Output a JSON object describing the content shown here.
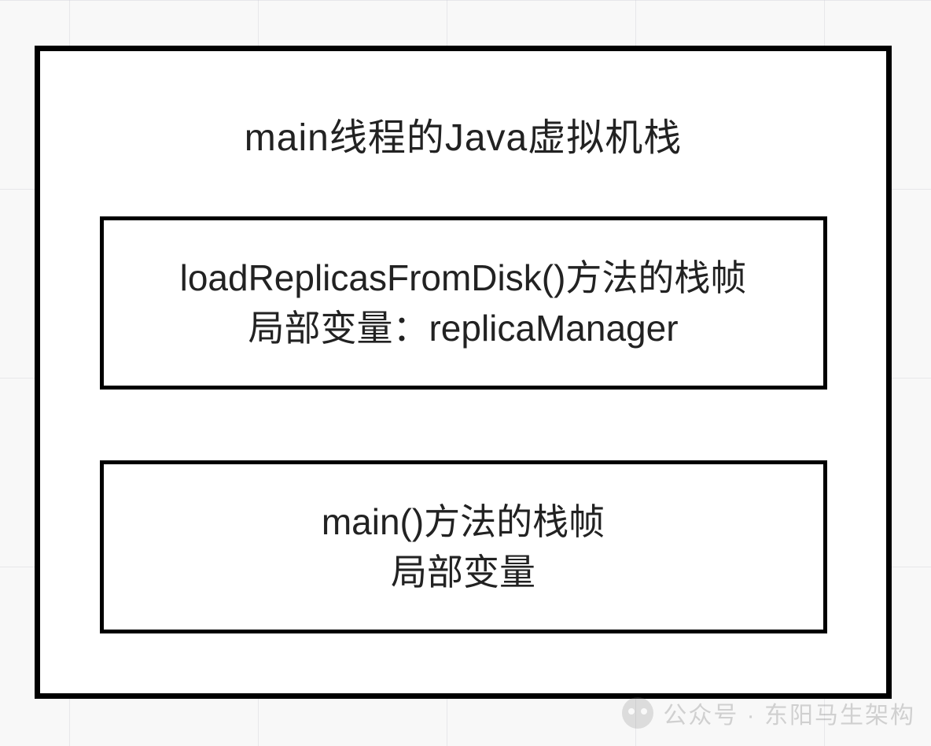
{
  "diagram": {
    "title": "main线程的Java虚拟机栈",
    "frames": [
      {
        "line1": "loadReplicasFromDisk()方法的栈帧",
        "line2": "局部变量：replicaManager"
      },
      {
        "line1": "main()方法的栈帧",
        "line2": "局部变量"
      }
    ]
  },
  "watermark": {
    "text": "公众号 · 东阳马生架构"
  }
}
